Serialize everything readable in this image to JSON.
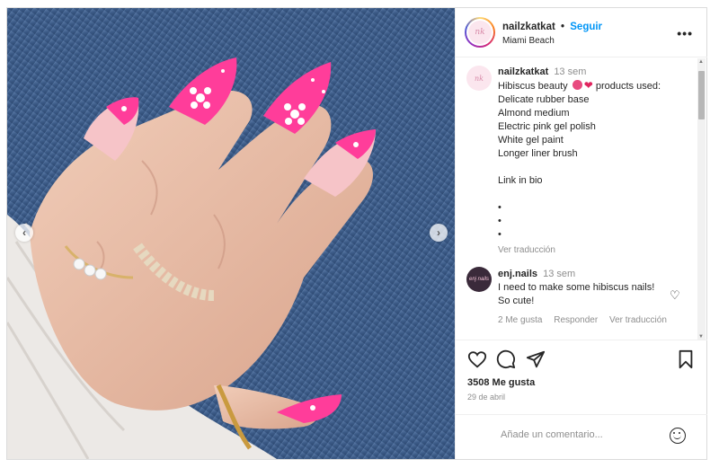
{
  "post": {
    "username": "nailzkatkat",
    "follow_label": "Seguir",
    "separator": "•",
    "location": "Miami Beach",
    "more_icon": "more-horizontal-icon",
    "avatar_text": "nk"
  },
  "caption": {
    "username": "nailzkatkat",
    "time": "13 sem",
    "lines": [
      "Hibiscus beauty",
      "products used:",
      "Delicate rubber base",
      "Almond medium",
      "Electric pink gel polish",
      "White gel paint",
      "Longer liner brush",
      "Link in bio",
      "•",
      "•",
      "•"
    ],
    "translate_label": "Ver traducción"
  },
  "comment": {
    "username": "enj.nails",
    "time": "13 sem",
    "text": "I need to make some hibiscus nails! So cute!",
    "likes_label": "2 Me gusta",
    "reply_label": "Responder",
    "translate_label": "Ver traducción",
    "avatar_text": "enj nails"
  },
  "stats": {
    "likes": "3508 Me gusta",
    "date": "29 de abril"
  },
  "add_comment": {
    "placeholder": "Añade un comentario..."
  },
  "photo": {
    "nav_left": "‹",
    "nav_right": "›"
  },
  "colors": {
    "accent": "#0095f6",
    "nail_pink": "#ff3d9a",
    "denim": "#3d5b85"
  }
}
